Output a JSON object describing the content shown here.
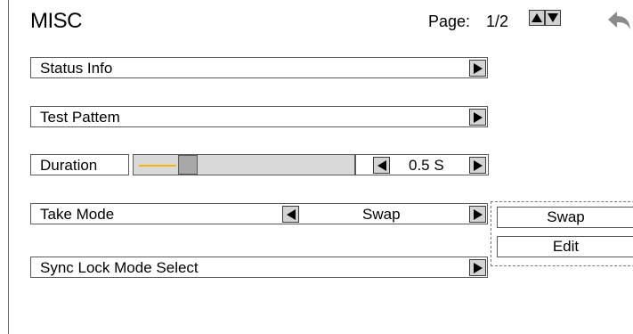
{
  "header": {
    "title": "MISC",
    "page_label": "Page:",
    "page_number": "1/2"
  },
  "rows": {
    "status_info": "Status Info",
    "test_pattern": "Test Pattem",
    "duration": "Duration",
    "take_mode": "Take Mode",
    "sync_lock": "Sync Lock Mode Select"
  },
  "duration": {
    "value": "0.5 S",
    "slider_fraction": 0.22
  },
  "take_mode": {
    "value": "Swap"
  },
  "dropdown": {
    "options": [
      "Swap",
      "Edit"
    ]
  },
  "icons": {
    "page_up": "triangle-up-icon",
    "page_down": "triangle-down-icon",
    "back": "back-arrow-icon",
    "row_arrow": "triangle-right-icon",
    "decrement": "triangle-left-icon"
  },
  "colors": {
    "slider_fill": "#f5b400",
    "button_bg": "#d4d4d4",
    "track_bg": "#d9d9d9"
  }
}
